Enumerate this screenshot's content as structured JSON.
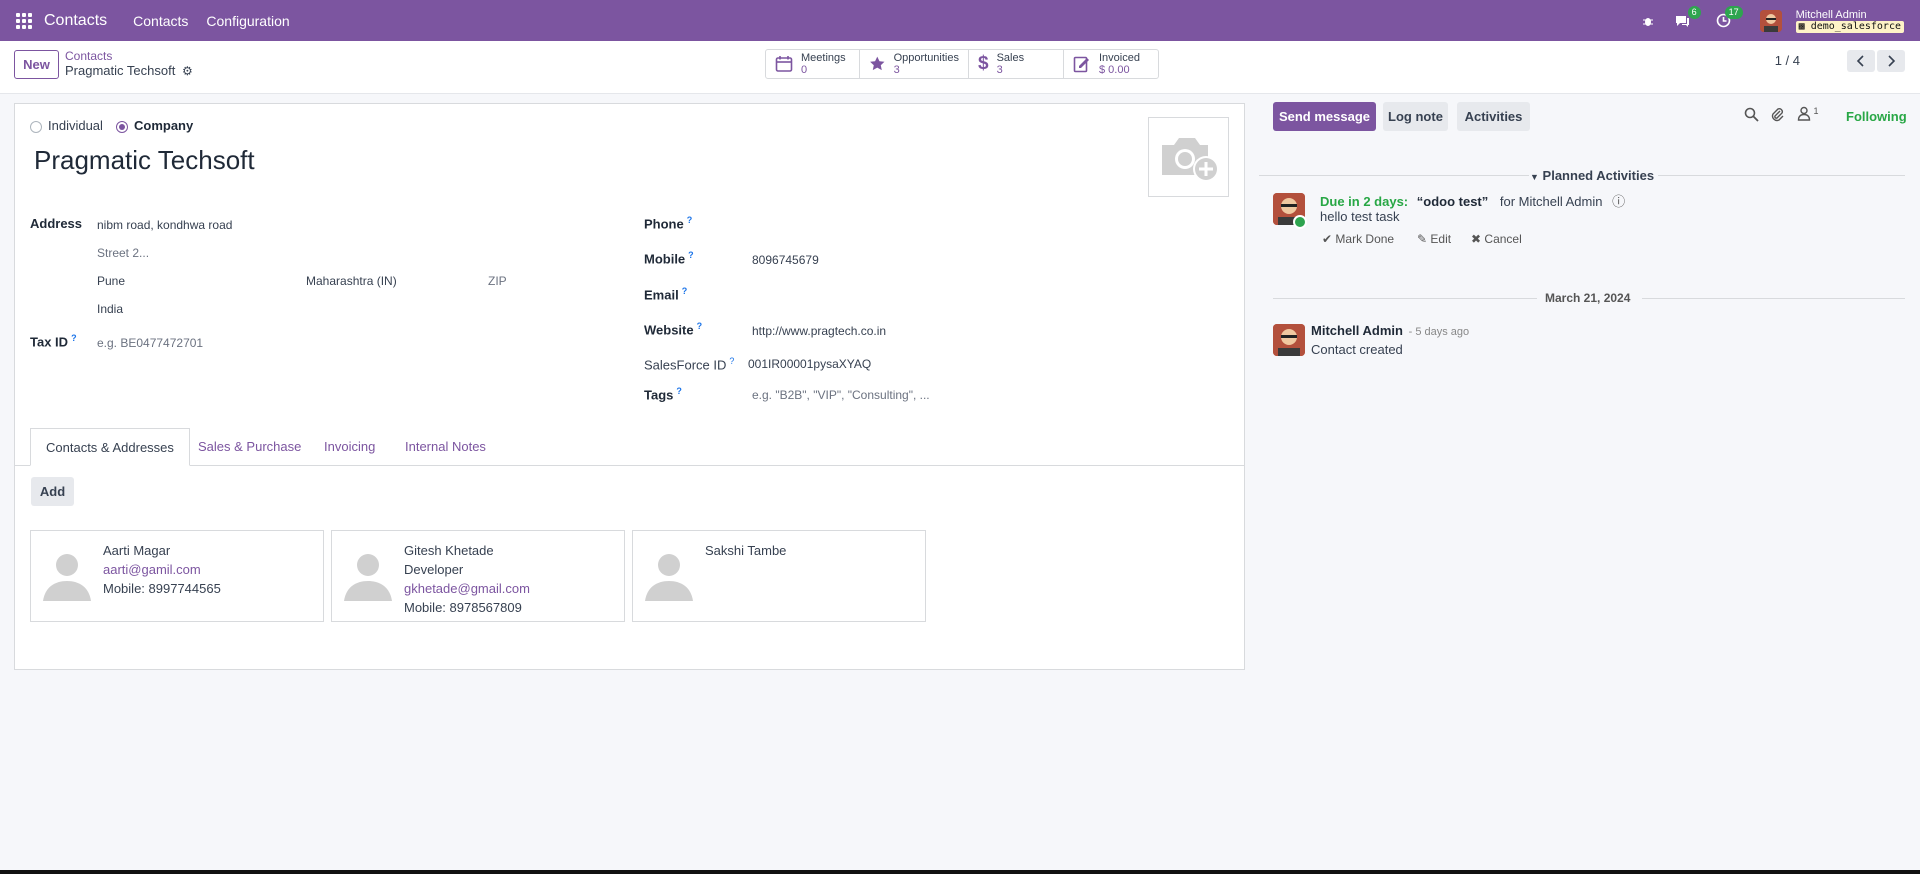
{
  "topbar": {
    "app_name": "Contacts",
    "menu": [
      "Contacts",
      "Configuration"
    ],
    "messages_count": "6",
    "activities_count": "17",
    "user_name": "Mitchell Admin",
    "database": "demo_salesforce"
  },
  "control": {
    "new_label": "New",
    "breadcrumb_parent": "Contacts",
    "breadcrumb_current": "Pragmatic Techsoft",
    "pager": "1 / 4",
    "smart_buttons": [
      {
        "label": "Meetings",
        "value": "0",
        "icon": "calendar-icon"
      },
      {
        "label": "Opportunities",
        "value": "3",
        "icon": "star-icon"
      },
      {
        "label": "Sales",
        "value": "3",
        "icon": "dollar-icon"
      },
      {
        "label": "Invoiced",
        "value": "$ 0.00",
        "icon": "invoice-icon"
      }
    ]
  },
  "form": {
    "type_individual": "Individual",
    "type_company": "Company",
    "name": "Pragmatic Techsoft",
    "address_label": "Address",
    "street": "nibm road, kondhwa road",
    "street2_placeholder": "Street 2...",
    "city": "Pune",
    "state": "Maharashtra (IN)",
    "zip_placeholder": "ZIP",
    "country": "India",
    "taxid_label": "Tax ID",
    "taxid_placeholder": "e.g. BE0477472701",
    "phone_label": "Phone",
    "mobile_label": "Mobile",
    "mobile": "8096745679",
    "email_label": "Email",
    "website_label": "Website",
    "website": "http://www.pragtech.co.in",
    "salesforce_label": "SalesForce ID",
    "salesforce_id": "001IR00001pysaXYAQ",
    "tags_label": "Tags",
    "tags_placeholder": "e.g. \"B2B\", \"VIP\", \"Consulting\", ...",
    "help_mark": "?"
  },
  "tabs": [
    "Contacts & Addresses",
    "Sales & Purchase",
    "Invoicing",
    "Internal Notes"
  ],
  "add_label": "Add",
  "contacts": [
    {
      "name": "Aarti Magar",
      "role": "",
      "email": "aarti@gamil.com",
      "mobile": "Mobile: 8997744565"
    },
    {
      "name": "Gitesh Khetade",
      "role": "Developer",
      "email": "gkhetade@gmail.com",
      "mobile": "Mobile: 8978567809"
    },
    {
      "name": "Sakshi Tambe",
      "role": "",
      "email": "",
      "mobile": ""
    }
  ],
  "chatter": {
    "send_message": "Send message",
    "log_note": "Log note",
    "activities": "Activities",
    "followers_count": "1",
    "following": "Following",
    "planned_title": "Planned Activities",
    "activity_due": "Due in 2 days:",
    "activity_name": "“odoo test”",
    "activity_for": "for Mitchell Admin",
    "activity_note": "hello test task",
    "mark_done": "Mark Done",
    "edit": "Edit",
    "cancel": "Cancel",
    "date_separator": "March 21, 2024",
    "msg_author": "Mitchell Admin",
    "msg_time": "- 5 days ago",
    "msg_body": "Contact created"
  }
}
